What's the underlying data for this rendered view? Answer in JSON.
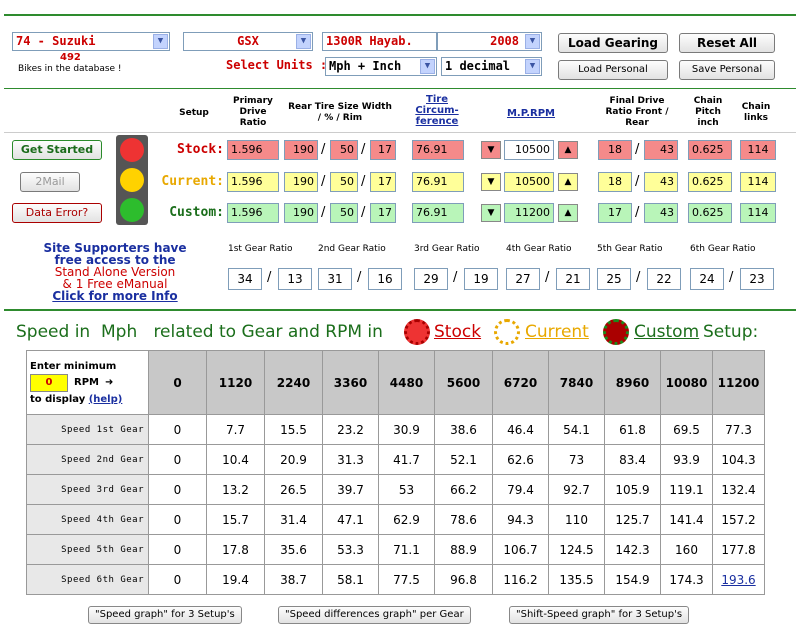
{
  "top": {
    "bike_select": "74 - Suzuki",
    "model_select": "GSX",
    "variant_select": "1300R Hayab.",
    "year_select": "2008",
    "bikes_count": "492",
    "bikes_text": "Bikes in the database !",
    "select_units_label": "Select Units :",
    "units_select": "Mph + Inch",
    "decimal_select": "1 decimal",
    "load_gearing": "Load Gearing",
    "reset_all": "Reset All",
    "load_personal": "Load Personal",
    "save_personal": "Save Personal"
  },
  "headers": {
    "setup": "Setup",
    "primary": "Primary Drive Ratio",
    "rear_tire": "Rear Tire Size Width / % / Rim",
    "tire_circ": "Tire Circum- ference",
    "mprpm": "M.P.RPM",
    "final_drive": "Final Drive Ratio Front / Rear",
    "chain_pitch": "Chain Pitch inch",
    "chain_links": "Chain links"
  },
  "side_buttons": {
    "get_started": "Get Started",
    "mail": "2Mail",
    "data_error": "Data Error?"
  },
  "setups": [
    {
      "label": "Stock:",
      "primary": "1.596",
      "width": "190",
      "pct": "50",
      "rim": "17",
      "circ": "76.91",
      "rpm": "10500",
      "front": "18",
      "rear": "43",
      "pitch": "0.625",
      "links": "114"
    },
    {
      "label": "Current:",
      "primary": "1.596",
      "width": "190",
      "pct": "50",
      "rim": "17",
      "circ": "76.91",
      "rpm": "10500",
      "front": "18",
      "rear": "43",
      "pitch": "0.625",
      "links": "114"
    },
    {
      "label": "Custom:",
      "primary": "1.596",
      "width": "190",
      "pct": "50",
      "rim": "17",
      "circ": "76.91",
      "rpm": "11200",
      "front": "17",
      "rear": "43",
      "pitch": "0.625",
      "links": "114"
    }
  ],
  "supporters": {
    "line1": "Site Supporters have",
    "line2": "free access to the",
    "line3": "Stand Alone Version",
    "line4": "& 1 Free eManual",
    "link": "Click for more Info"
  },
  "gear_ratio_headers": [
    "1st Gear Ratio",
    "2nd Gear Ratio",
    "3rd Gear Ratio",
    "4th Gear Ratio",
    "5th Gear Ratio",
    "6th Gear Ratio"
  ],
  "gear_ratios": [
    [
      "34",
      "13"
    ],
    [
      "31",
      "16"
    ],
    [
      "29",
      "19"
    ],
    [
      "27",
      "21"
    ],
    [
      "25",
      "22"
    ],
    [
      "24",
      "23"
    ]
  ],
  "speed_section": {
    "title_prefix": "Speed in  Mph   related to Gear and RPM in",
    "stock": "Stock",
    "current": "Current",
    "custom": "Custom",
    "setup_word": "Setup:",
    "enter_min": "Enter minimum",
    "min_value": "0",
    "rpm_label": "RPM",
    "to_display": "to display",
    "help": "(help)"
  },
  "rpm_columns": [
    "0",
    "1120",
    "2240",
    "3360",
    "4480",
    "5600",
    "6720",
    "7840",
    "8960",
    "10080",
    "11200"
  ],
  "speed_rows": [
    {
      "label": "Speed 1st Gear",
      "values": [
        "0",
        "7.7",
        "15.5",
        "23.2",
        "30.9",
        "38.6",
        "46.4",
        "54.1",
        "61.8",
        "69.5",
        "77.3"
      ]
    },
    {
      "label": "Speed 2nd Gear",
      "values": [
        "0",
        "10.4",
        "20.9",
        "31.3",
        "41.7",
        "52.1",
        "62.6",
        "73",
        "83.4",
        "93.9",
        "104.3"
      ]
    },
    {
      "label": "Speed 3rd Gear",
      "values": [
        "0",
        "13.2",
        "26.5",
        "39.7",
        "53",
        "66.2",
        "79.4",
        "92.7",
        "105.9",
        "119.1",
        "132.4"
      ]
    },
    {
      "label": "Speed 4th Gear",
      "values": [
        "0",
        "15.7",
        "31.4",
        "47.1",
        "62.9",
        "78.6",
        "94.3",
        "110",
        "125.7",
        "141.4",
        "157.2"
      ]
    },
    {
      "label": "Speed 5th Gear",
      "values": [
        "0",
        "17.8",
        "35.6",
        "53.3",
        "71.1",
        "88.9",
        "106.7",
        "124.5",
        "142.3",
        "160",
        "177.8"
      ]
    },
    {
      "label": "Speed 6th Gear",
      "values": [
        "0",
        "19.4",
        "38.7",
        "58.1",
        "77.5",
        "96.8",
        "116.2",
        "135.5",
        "154.9",
        "174.3",
        "193.6"
      ]
    }
  ],
  "bottom_buttons": [
    "\"Speed graph\" for 3 Setup's",
    "\"Speed differences graph\" per Gear",
    "\"Shift-Speed graph\" for 3 Setup's"
  ]
}
